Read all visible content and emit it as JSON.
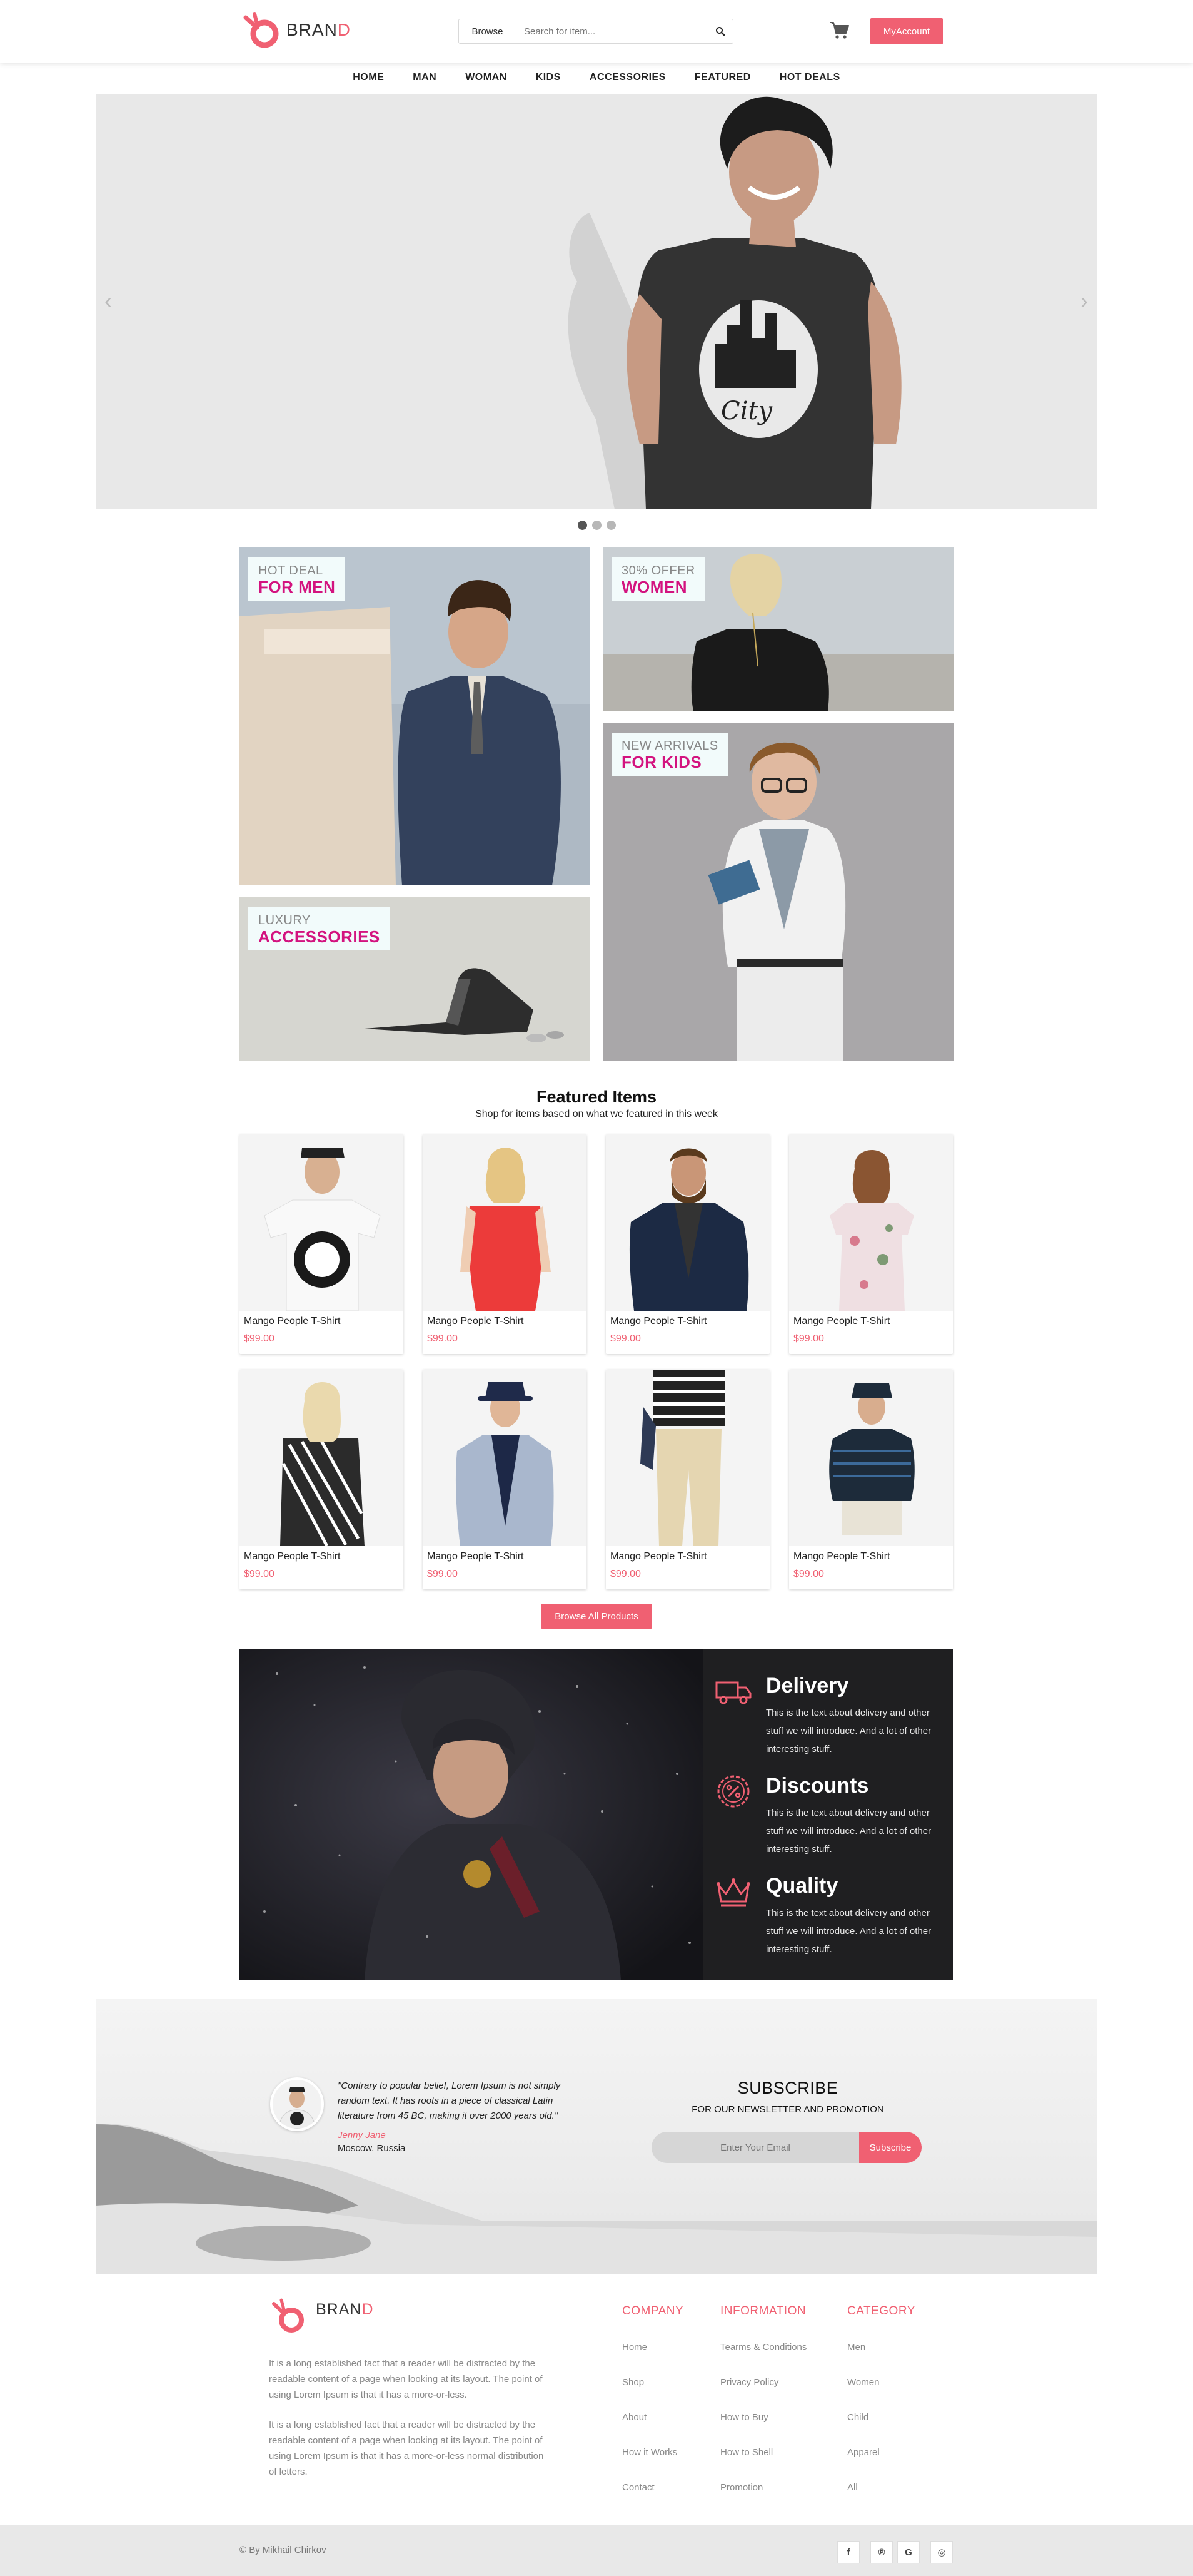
{
  "header": {
    "brand_main": "BRAN",
    "brand_accent": "D",
    "browse_label": "Browse",
    "search_placeholder": "Search for item...",
    "account_label": "MyAccount"
  },
  "nav": [
    "HOME",
    "MAN",
    "WOMAN",
    "KIDS",
    "ACCESSORIES",
    "FEATURED",
    "HOT DEALS"
  ],
  "hero": {
    "prev": "‹",
    "next": "›",
    "slides": 3,
    "active_slide": 1
  },
  "promos": {
    "men": {
      "small": "HOT DEAL",
      "big": "FOR MEN"
    },
    "women": {
      "small": "30% OFFER",
      "big": "WOMEN"
    },
    "accessories": {
      "small": "LUXURY",
      "big": "ACCESSORIES"
    },
    "kids": {
      "small": "NEW ARRIVALS",
      "big": "FOR KIDS"
    }
  },
  "featured": {
    "title": "Featured Items",
    "subtitle": "Shop for items based on what we featured in this week",
    "items": [
      {
        "name": "Mango People T-Shirt",
        "price": "$99.00"
      },
      {
        "name": "Mango People T-Shirt",
        "price": "$99.00"
      },
      {
        "name": "Mango People T-Shirt",
        "price": "$99.00"
      },
      {
        "name": "Mango People T-Shirt",
        "price": "$99.00"
      },
      {
        "name": "Mango People T-Shirt",
        "price": "$99.00"
      },
      {
        "name": "Mango People T-Shirt",
        "price": "$99.00"
      },
      {
        "name": "Mango People T-Shirt",
        "price": "$99.00"
      },
      {
        "name": "Mango People T-Shirt",
        "price": "$99.00"
      }
    ],
    "browse_all": "Browse All Products"
  },
  "features": [
    {
      "icon": "truck-icon",
      "title": "Delivery",
      "text": "This is the text about delivery and other stuff we will introduce. And a lot of other interesting stuff."
    },
    {
      "icon": "percent-icon",
      "title": "Discounts",
      "text": "This is the text about delivery and other stuff we will introduce. And a lot of other interesting stuff."
    },
    {
      "icon": "crown-icon",
      "title": "Quality",
      "text": "This is the text about delivery and other stuff we will introduce. And a lot of other interesting stuff."
    }
  ],
  "testimonial": {
    "quote": "\"Contrary to popular belief, Lorem Ipsum is not simply random text. It has roots in a piece of classical Latin literature from 45 BC, making it over 2000 years old.\"",
    "name": "Jenny Jane",
    "city": "Moscow, Russia"
  },
  "subscribe": {
    "title": "SUBSCRIBE",
    "subtitle": "FOR OUR NEWSLETTER AND PROMOTION",
    "placeholder": "Enter Your Email",
    "button": "Subscribe"
  },
  "footer": {
    "brand_main": "BRAN",
    "brand_accent": "D",
    "para1": "It is a long established fact that a reader will be distracted by the readable content of a page when looking at its layout. The point of using Lorem Ipsum is that it has a more-or-less.",
    "para2": "It is a long established fact that a reader will be distracted by the readable content of a page when looking at its layout. The point of using Lorem Ipsum is that it has a more-or-less normal distribution of letters.",
    "columns": [
      {
        "title": "COMPANY",
        "links": [
          "Home",
          "Shop",
          "About",
          "How it Works",
          "Contact"
        ]
      },
      {
        "title": "INFORMATION",
        "links": [
          "Tearms & Conditions",
          "Privacy Policy",
          "How to Buy",
          "How to Shell",
          "Promotion"
        ]
      },
      {
        "title": "CATEGORY",
        "links": [
          "Men",
          "Women",
          "Child",
          "Apparel",
          "All"
        ]
      }
    ],
    "copyright": "© By Mikhail Chirkov",
    "social": [
      {
        "icon": "facebook-icon",
        "glyph": "f"
      },
      {
        "icon": "pinterest-icon",
        "glyph": "℗"
      },
      {
        "icon": "google-plus-icon",
        "glyph": "G"
      },
      {
        "icon": "instagram-icon",
        "glyph": "◎"
      }
    ]
  },
  "colors": {
    "accent": "#f06072",
    "magenta": "#d3137f",
    "dark_panel": "#1f1f21"
  }
}
